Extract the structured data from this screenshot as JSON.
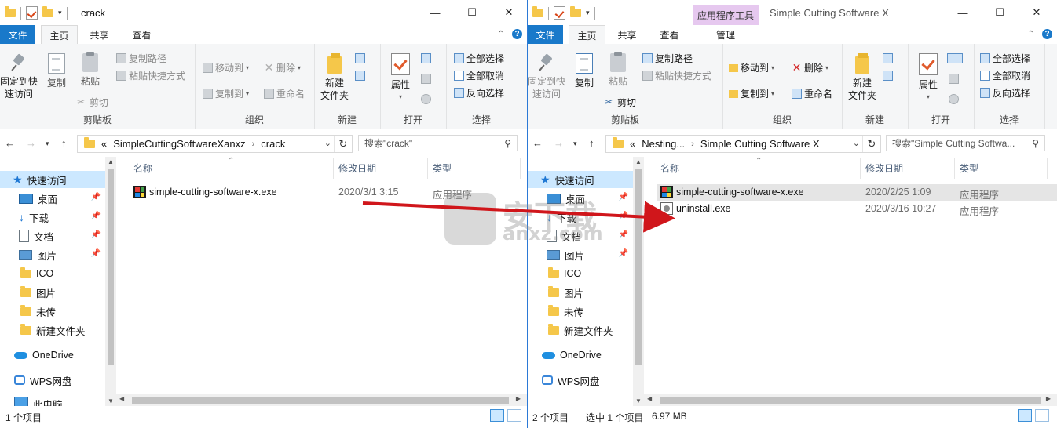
{
  "left_window": {
    "title": "crack",
    "tabs": {
      "file": "文件",
      "home": "主页",
      "share": "共享",
      "view": "查看"
    },
    "ribbon": {
      "clipboard": {
        "pin": "固定到快",
        "pin2": "速访问",
        "copy": "复制",
        "paste": "粘贴",
        "copy_path": "复制路径",
        "paste_shortcut": "粘贴快捷方式",
        "cut": "剪切",
        "label": "剪贴板"
      },
      "organize": {
        "move_to": "移动到",
        "copy_to": "复制到",
        "delete": "删除",
        "rename": "重命名",
        "label": "组织"
      },
      "new": {
        "new_folder": "新建",
        "new_folder2": "文件夹",
        "label": "新建"
      },
      "open": {
        "properties": "属性",
        "label": "打开"
      },
      "select": {
        "select_all": "全部选择",
        "select_none": "全部取消",
        "invert": "反向选择",
        "label": "选择"
      }
    },
    "address": {
      "overflow": "«",
      "crumbs": [
        "SimpleCuttingSoftwareXanxz",
        "crack"
      ]
    },
    "search_placeholder": "搜索\"crack\"",
    "columns": {
      "name": "名称",
      "modified": "修改日期",
      "type": "类型"
    },
    "files": [
      {
        "name": "simple-cutting-software-x.exe",
        "modified": "2020/3/1 3:15",
        "type": "应用程序",
        "icon": "exe-icon"
      }
    ],
    "status": {
      "count": "1 个项目"
    }
  },
  "right_window": {
    "title": "Simple Cutting Software X",
    "context_tab": "应用程序工具",
    "tabs": {
      "file": "文件",
      "home": "主页",
      "share": "共享",
      "view": "查看",
      "manage": "管理"
    },
    "ribbon": {
      "clipboard": {
        "pin": "固定到快",
        "pin2": "速访问",
        "copy": "复制",
        "paste": "粘贴",
        "copy_path": "复制路径",
        "paste_shortcut": "粘贴快捷方式",
        "cut": "剪切",
        "label": "剪贴板"
      },
      "organize": {
        "move_to": "移动到",
        "copy_to": "复制到",
        "delete": "删除",
        "rename": "重命名",
        "label": "组织"
      },
      "new": {
        "new_folder": "新建",
        "new_folder2": "文件夹",
        "label": "新建"
      },
      "open": {
        "properties": "属性",
        "label": "打开"
      },
      "select": {
        "select_all": "全部选择",
        "select_none": "全部取消",
        "invert": "反向选择",
        "label": "选择"
      }
    },
    "address": {
      "overflow": "«",
      "crumbs": [
        "Nesting...",
        "Simple Cutting Software X"
      ]
    },
    "search_placeholder": "搜索\"Simple Cutting Softwa...",
    "columns": {
      "name": "名称",
      "modified": "修改日期",
      "type": "类型"
    },
    "files": [
      {
        "name": "simple-cutting-software-x.exe",
        "modified": "2020/2/25 1:09",
        "type": "应用程序",
        "icon": "exe-icon",
        "selected": true
      },
      {
        "name": "uninstall.exe",
        "modified": "2020/3/16 10:27",
        "type": "应用程序",
        "icon": "uninstall-icon",
        "selected": false
      }
    ],
    "status": {
      "count": "2 个项目",
      "selection": "选中 1 个项目",
      "size": "6.97 MB"
    }
  },
  "nav_pane": {
    "quick_access": "快速访问",
    "items": [
      "桌面",
      "下载",
      "文档",
      "图片",
      "ICO",
      "图片",
      "未传",
      "新建文件夹"
    ],
    "onedrive": "OneDrive",
    "wps": "WPS网盘",
    "this_pc": "此电脑"
  },
  "window_controls": {
    "minimize": "—",
    "maximize": "☐",
    "close": "✕"
  },
  "watermark": {
    "cn": "安下载",
    "en": "anxz.com"
  },
  "colors": {
    "accent": "#1979ca",
    "selection": "#cce8ff",
    "arrow": "#d0161b",
    "context_tab": "#e6c8ef"
  }
}
